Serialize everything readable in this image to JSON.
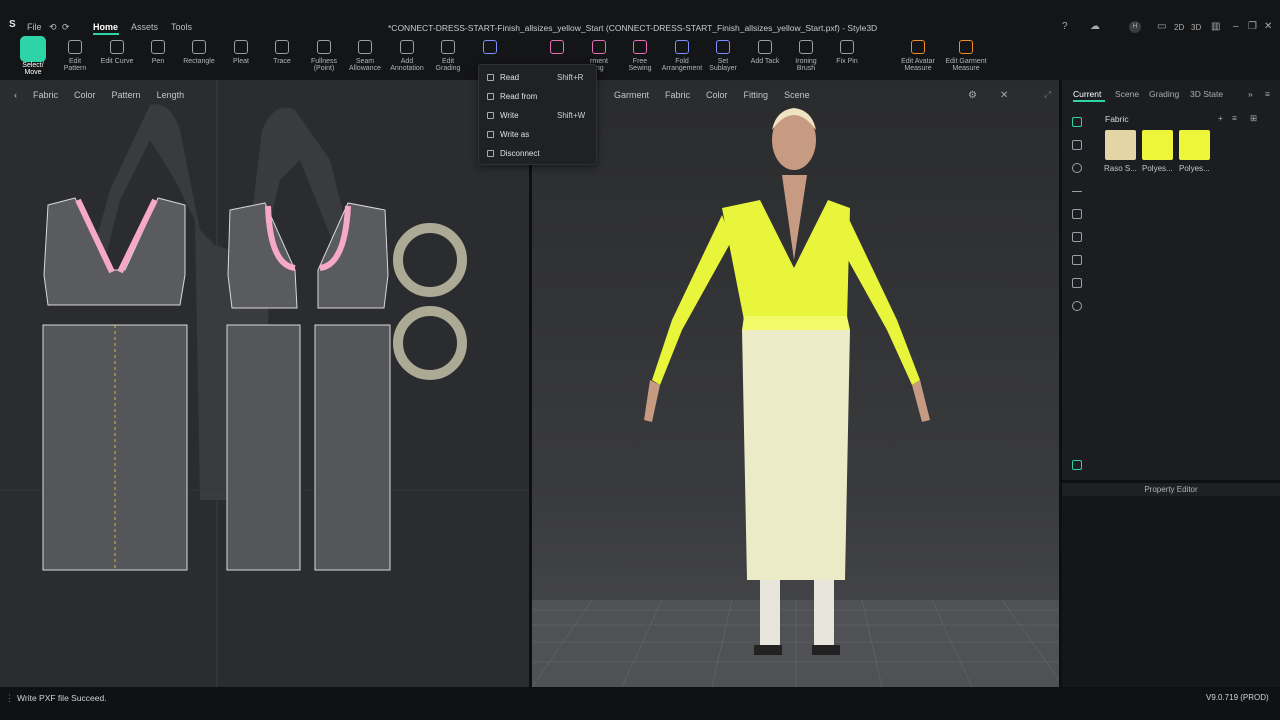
{
  "app": {
    "logo": "S",
    "title": "*CONNECT-DRESS-START-Finish_allsizes_yellow_Start (CONNECT-DRESS-START_Finish_allsizes_yellow_Start.pxf) - Style3D"
  },
  "menu": {
    "file": "File",
    "home": "Home",
    "assets": "Assets",
    "tools": "Tools"
  },
  "window": {
    "view_2d": "2D",
    "view_3d": "3D",
    "user_initial": "H"
  },
  "toolbar": {
    "tools": [
      {
        "label": "Select/\nMove"
      },
      {
        "label": "Edit\nPattern"
      },
      {
        "label": "Edit Curve"
      },
      {
        "label": "Pen"
      },
      {
        "label": "Rectangle"
      },
      {
        "label": "Pleat"
      },
      {
        "label": "Trace"
      },
      {
        "label": "Fullness\n(Point)"
      },
      {
        "label": "Seam\nAllowance"
      },
      {
        "label": "Add\nAnnotation"
      },
      {
        "label": "Edit\nGrading"
      },
      {
        "label": ""
      },
      {
        "label": ""
      },
      {
        "label": "rment\ning"
      },
      {
        "label": "Free\nSewing"
      },
      {
        "label": "Fold\nArrangement"
      },
      {
        "label": "Set\nSublayer"
      },
      {
        "label": "Add Tack"
      },
      {
        "label": "Ironing\nBrush"
      },
      {
        "label": "Fix Pin"
      },
      {
        "label": "Edit Avatar\nMeasure"
      },
      {
        "label": "Edit Garment\nMeasure"
      }
    ]
  },
  "dropdown": {
    "items": [
      {
        "label": "Read",
        "shortcut": "Shift+R"
      },
      {
        "label": "Read from",
        "shortcut": ""
      },
      {
        "label": "Write",
        "shortcut": "Shift+W"
      },
      {
        "label": "Write as",
        "shortcut": ""
      },
      {
        "label": "Disconnect",
        "shortcut": ""
      }
    ]
  },
  "panel2d": {
    "items": [
      "Fabric",
      "Color",
      "Pattern",
      "Length"
    ]
  },
  "panel3d": {
    "items": [
      "Garment",
      "Fabric",
      "Color",
      "Fitting",
      "Scene"
    ]
  },
  "rightpanel": {
    "tabs": [
      "Current",
      "Scene",
      "Grading",
      "3D State"
    ],
    "section": "Fabric",
    "fabrics": [
      {
        "name": "Raso S...",
        "color": "#e3d5a6"
      },
      {
        "name": "Polyes...",
        "color": "#eef53a"
      },
      {
        "name": "Polyes...",
        "color": "#eef53a"
      }
    ]
  },
  "property_editor": "Property Editor",
  "status": {
    "message": "Write PXF file Succeed.",
    "version": "V9.0.719 (PROD)"
  },
  "colors": {
    "accent": "#2fd3a8",
    "ai": "#8b5cf6",
    "blouse": "#e9f53a",
    "skirt": "#ecebc8"
  }
}
